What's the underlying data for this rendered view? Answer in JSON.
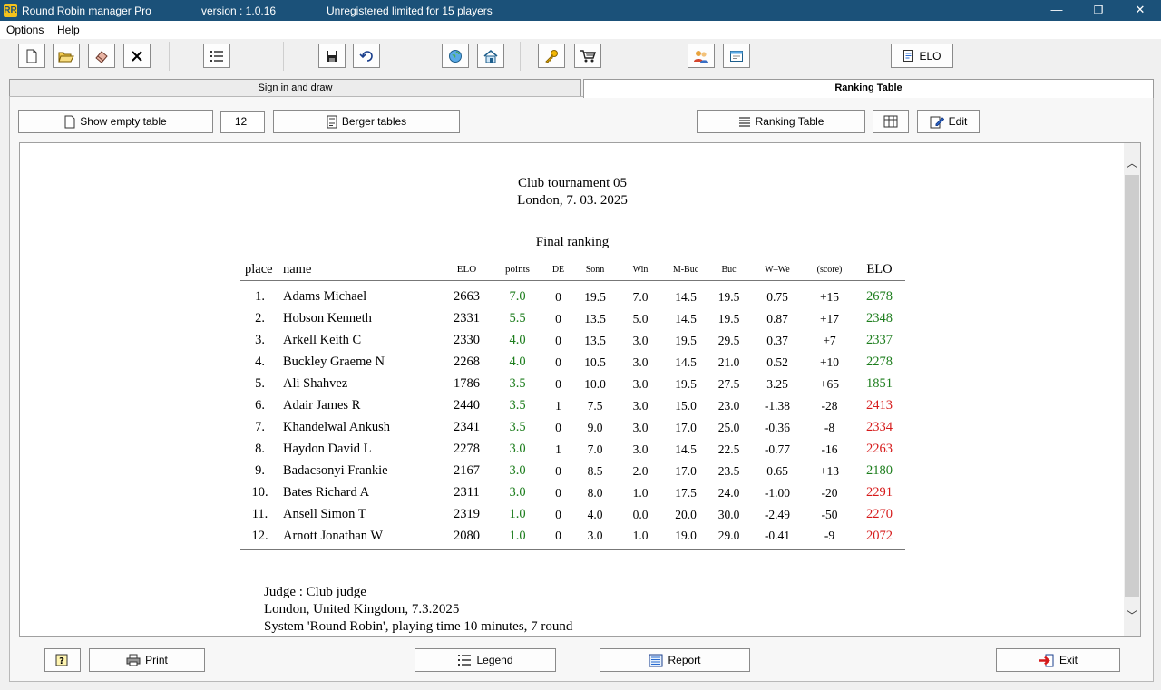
{
  "window": {
    "app_title": "Round Robin manager Pro",
    "version": "version : 1.0.16",
    "license": "Unregistered limited for 15 players",
    "app_icon_text": "RR",
    "minimize_glyph": "—",
    "maximize_glyph": "❐",
    "close_glyph": "✕"
  },
  "menu": {
    "options": "Options",
    "help": "Help"
  },
  "toolbar": {
    "elo_label": "ELO"
  },
  "tabs": {
    "sign_in": "Sign in and draw",
    "ranking": "Ranking Table"
  },
  "controls": {
    "show_empty": "Show empty table",
    "player_count": "12",
    "berger": "Berger tables",
    "ranking_table": "Ranking Table",
    "edit": "Edit"
  },
  "report": {
    "tournament": "Club tournament 05",
    "place_date": "London, 7. 03. 2025",
    "section_title": "Final ranking",
    "columns": [
      "place",
      "name",
      "ELO",
      "points",
      "DE",
      "Sonn",
      "Win",
      "M-Buc",
      "Buc",
      "W–We",
      "(score)",
      "ELO"
    ],
    "rows": [
      {
        "place": "1.",
        "name": "Adams Michael",
        "elo": "2663",
        "points": "7.0",
        "de": "0",
        "sonn": "19.5",
        "win": "7.0",
        "mbuc": "14.5",
        "buc": "19.5",
        "wwe": "0.75",
        "score": "+15",
        "new_elo": "2678"
      },
      {
        "place": "2.",
        "name": "Hobson Kenneth",
        "elo": "2331",
        "points": "5.5",
        "de": "0",
        "sonn": "13.5",
        "win": "5.0",
        "mbuc": "14.5",
        "buc": "19.5",
        "wwe": "0.87",
        "score": "+17",
        "new_elo": "2348"
      },
      {
        "place": "3.",
        "name": "Arkell Keith C",
        "elo": "2330",
        "points": "4.0",
        "de": "0",
        "sonn": "13.5",
        "win": "3.0",
        "mbuc": "19.5",
        "buc": "29.5",
        "wwe": "0.37",
        "score": "+7",
        "new_elo": "2337"
      },
      {
        "place": "4.",
        "name": "Buckley Graeme N",
        "elo": "2268",
        "points": "4.0",
        "de": "0",
        "sonn": "10.5",
        "win": "3.0",
        "mbuc": "14.5",
        "buc": "21.0",
        "wwe": "0.52",
        "score": "+10",
        "new_elo": "2278"
      },
      {
        "place": "5.",
        "name": "Ali Shahvez",
        "elo": "1786",
        "points": "3.5",
        "de": "0",
        "sonn": "10.0",
        "win": "3.0",
        "mbuc": "19.5",
        "buc": "27.5",
        "wwe": "3.25",
        "score": "+65",
        "new_elo": "1851"
      },
      {
        "place": "6.",
        "name": "Adair James R",
        "elo": "2440",
        "points": "3.5",
        "de": "1",
        "sonn": "7.5",
        "win": "3.0",
        "mbuc": "15.0",
        "buc": "23.0",
        "wwe": "-1.38",
        "score": "-28",
        "new_elo": "2413"
      },
      {
        "place": "7.",
        "name": "Khandelwal Ankush",
        "elo": "2341",
        "points": "3.5",
        "de": "0",
        "sonn": "9.0",
        "win": "3.0",
        "mbuc": "17.0",
        "buc": "25.0",
        "wwe": "-0.36",
        "score": "-8",
        "new_elo": "2334"
      },
      {
        "place": "8.",
        "name": "Haydon David L",
        "elo": "2278",
        "points": "3.0",
        "de": "1",
        "sonn": "7.0",
        "win": "3.0",
        "mbuc": "14.5",
        "buc": "22.5",
        "wwe": "-0.77",
        "score": "-16",
        "new_elo": "2263"
      },
      {
        "place": "9.",
        "name": "Badacsonyi Frankie",
        "elo": "2167",
        "points": "3.0",
        "de": "0",
        "sonn": "8.5",
        "win": "2.0",
        "mbuc": "17.0",
        "buc": "23.5",
        "wwe": "0.65",
        "score": "+13",
        "new_elo": "2180"
      },
      {
        "place": "10.",
        "name": "Bates Richard A",
        "elo": "2311",
        "points": "3.0",
        "de": "0",
        "sonn": "8.0",
        "win": "1.0",
        "mbuc": "17.5",
        "buc": "24.0",
        "wwe": "-1.00",
        "score": "-20",
        "new_elo": "2291"
      },
      {
        "place": "11.",
        "name": "Ansell Simon T",
        "elo": "2319",
        "points": "1.0",
        "de": "0",
        "sonn": "4.0",
        "win": "0.0",
        "mbuc": "20.0",
        "buc": "30.0",
        "wwe": "-2.49",
        "score": "-50",
        "new_elo": "2270"
      },
      {
        "place": "12.",
        "name": "Arnott Jonathan W",
        "elo": "2080",
        "points": "1.0",
        "de": "0",
        "sonn": "3.0",
        "win": "1.0",
        "mbuc": "19.0",
        "buc": "29.0",
        "wwe": "-0.41",
        "score": "-9",
        "new_elo": "2072"
      }
    ],
    "judge": "Judge : Club judge",
    "venue": "London, United Kingdom, 7.3.2025",
    "system": "System 'Round Robin', playing time 10 minutes, 7 round"
  },
  "bottom": {
    "print": "Print",
    "legend": "Legend",
    "report": "Report",
    "exit": "Exit"
  },
  "colors": {
    "titlebar": "#1b5179",
    "rating_up": "#1c7d1c",
    "rating_down": "#d61a1a"
  }
}
